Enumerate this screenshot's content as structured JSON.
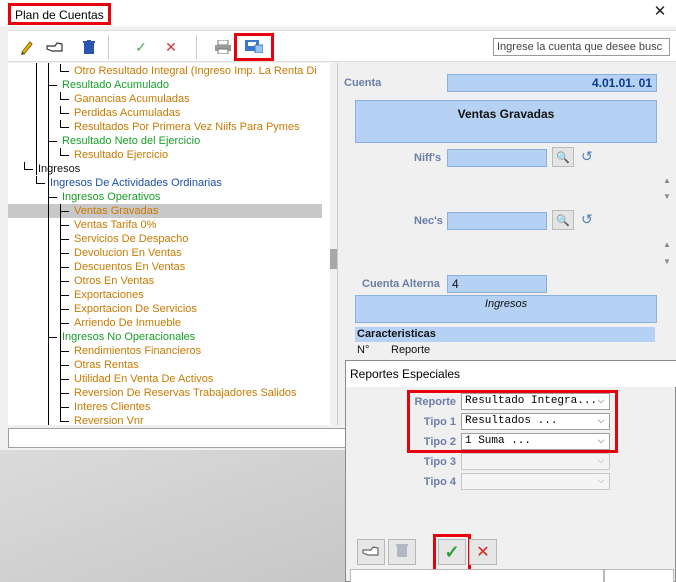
{
  "window": {
    "title": "Plan de Cuentas",
    "close_label": "✕"
  },
  "toolbar": {
    "search_placeholder": "Ingrese la cuenta que desee busc",
    "icons": [
      "pencil-icon",
      "hand-pointer-icon",
      "trash-icon",
      "check-icon",
      "cancel-icon",
      "printer-icon",
      "export-icon"
    ]
  },
  "tree": {
    "rows": [
      {
        "label": "Otro Resultado Integral  (Ingreso Imp. La Renta Di",
        "color": "orange"
      },
      {
        "label": "Resultado Acumulado",
        "color": "green"
      },
      {
        "label": "Ganancias Acumuladas",
        "color": "orange"
      },
      {
        "label": "Perdidas Acumuladas",
        "color": "orange"
      },
      {
        "label": "Resultados Por Primera Vez Niifs Para Pymes",
        "color": "orange"
      },
      {
        "label": "Resultado Neto del Ejercicio",
        "color": "green"
      },
      {
        "label": "Resultado Ejercicio",
        "color": "orange"
      },
      {
        "label": "Ingresos",
        "color": "black"
      },
      {
        "label": "Ingresos  De Actividades Ordinarias",
        "color": "blue"
      },
      {
        "label": "Ingresos Operativos",
        "color": "green"
      },
      {
        "label": "Ventas Gravadas",
        "color": "orange"
      },
      {
        "label": "Ventas Tarifa 0%",
        "color": "orange"
      },
      {
        "label": "Servicios De Despacho",
        "color": "orange"
      },
      {
        "label": "Devolucion En Ventas",
        "color": "orange"
      },
      {
        "label": "Descuentos En Ventas",
        "color": "orange"
      },
      {
        "label": "Otros En Ventas",
        "color": "orange"
      },
      {
        "label": "Exportaciones",
        "color": "orange"
      },
      {
        "label": "Exportacion De Servicios",
        "color": "orange"
      },
      {
        "label": "Arriendo De Inmueble",
        "color": "orange"
      },
      {
        "label": "Ingresos No Operacionales",
        "color": "green"
      },
      {
        "label": "Rendimientos Financieros",
        "color": "orange"
      },
      {
        "label": "Otras Rentas",
        "color": "orange"
      },
      {
        "label": "Utilidad En Venta De Activos",
        "color": "orange"
      },
      {
        "label": "Reversion De Reservas Trabajadores Salidos",
        "color": "orange"
      },
      {
        "label": "Interes Clientes",
        "color": "orange"
      },
      {
        "label": "Reversion Vnr",
        "color": "orange"
      }
    ]
  },
  "detail": {
    "cuenta_label": "Cuenta",
    "cuenta_value": "4.01.01.  01",
    "cuenta_name": "Ventas Gravadas",
    "niifs_label": "Niff's",
    "necs_label": "Nec's",
    "alterna_label": "Cuenta Alterna",
    "alterna_value": "4",
    "alterna_name": "Ingresos",
    "caract_header": "Caracteristicas",
    "caract_col1": "N°",
    "caract_col2": "Reporte"
  },
  "dialog": {
    "title": "Reportes Especiales",
    "fields": [
      {
        "label": "Reporte",
        "value": "Resultado Integra..."
      },
      {
        "label": "Tipo 1",
        "value": "Resultados        ..."
      },
      {
        "label": "Tipo 2",
        "value": "1          Suma ..."
      },
      {
        "label": "Tipo 3",
        "value": ""
      },
      {
        "label": "Tipo 4",
        "value": ""
      }
    ]
  },
  "colors": {
    "accent_blue": "#b5d2f5",
    "highlight_red": "#e8000b",
    "label_blue": "#6a7ea8"
  }
}
